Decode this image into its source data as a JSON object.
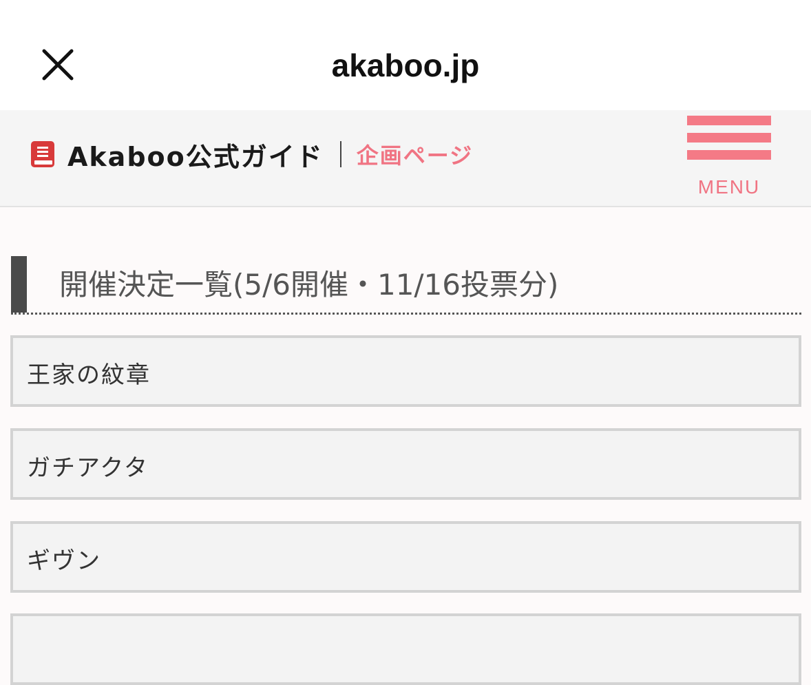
{
  "browser": {
    "domain": "akaboo.jp",
    "close_icon": "close-icon"
  },
  "header": {
    "site_name": "Akaboo公式ガイド",
    "subtitle": "企画ページ",
    "logo_icon": "book-icon",
    "menu_label": "MENU",
    "accent_color": "#f47a86",
    "brand_red": "#d83a3a"
  },
  "section": {
    "heading": "開催決定一覧(5/6開催・11/16投票分)"
  },
  "entries": [
    {
      "label": "王家の紋章"
    },
    {
      "label": "ガチアクタ"
    },
    {
      "label": "ギヴン"
    },
    {
      "label": ""
    }
  ]
}
